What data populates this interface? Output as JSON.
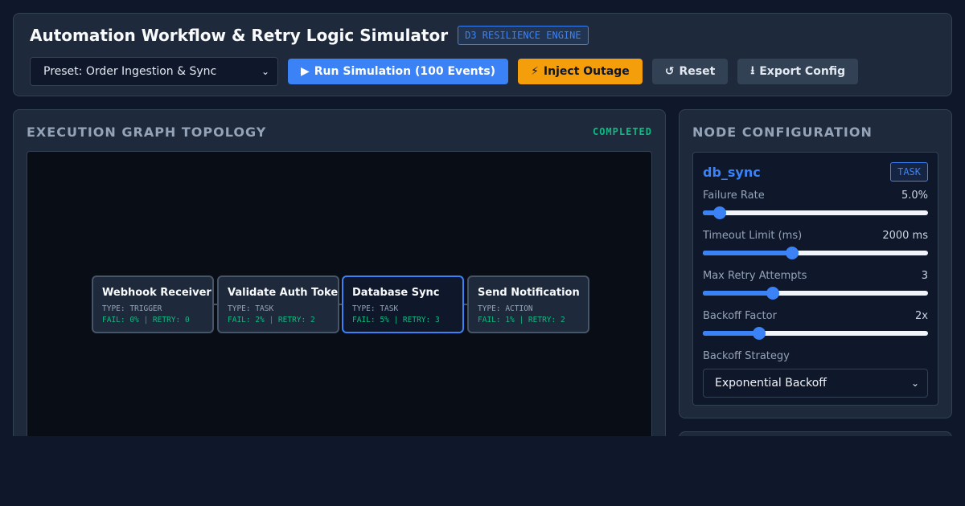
{
  "header": {
    "title": "Automation Workflow & Retry Logic Simulator",
    "badge": "D3 RESILIENCE ENGINE",
    "preset": "Preset: Order Ingestion & Sync",
    "buttons": {
      "run": "Run Simulation (100 Events)",
      "outage": "Inject Outage",
      "reset": "Reset",
      "export": "Export Config"
    },
    "icons": {
      "run": "▶",
      "outage": "⚡",
      "reset": "↺",
      "export": "⭳"
    }
  },
  "graph": {
    "title": "EXECUTION GRAPH TOPOLOGY",
    "status": "COMPLETED",
    "status_color": "#10b981",
    "nodes": [
      {
        "name": "Webhook Receiver",
        "type": "TYPE: TRIGGER",
        "stats": "FAIL: 0% | RETRY: 0"
      },
      {
        "name": "Validate Auth Token",
        "type": "TYPE: TASK",
        "stats": "FAIL: 2% | RETRY: 2"
      },
      {
        "name": "Database Sync",
        "type": "TYPE: TASK",
        "stats": "FAIL: 5% | RETRY: 3"
      },
      {
        "name": "Send Notification",
        "type": "TYPE: ACTION",
        "stats": "FAIL: 1% | RETRY: 2"
      }
    ]
  },
  "config": {
    "title": "NODE CONFIGURATION",
    "node_id": "db_sync",
    "node_type": "TASK",
    "accent": "#3b82f6",
    "params": [
      {
        "label": "Failure Rate",
        "value": "5.0%",
        "fraction": 0.075
      },
      {
        "label": "Timeout Limit (ms)",
        "value": "2000 ms",
        "fraction": 0.395
      },
      {
        "label": "Max Retry Attempts",
        "value": "3",
        "fraction": 0.31
      },
      {
        "label": "Backoff Factor",
        "value": "2x",
        "fraction": 0.25
      }
    ],
    "strategy_label": "Backoff Strategy",
    "strategy_value": "Exponential Backoff"
  }
}
